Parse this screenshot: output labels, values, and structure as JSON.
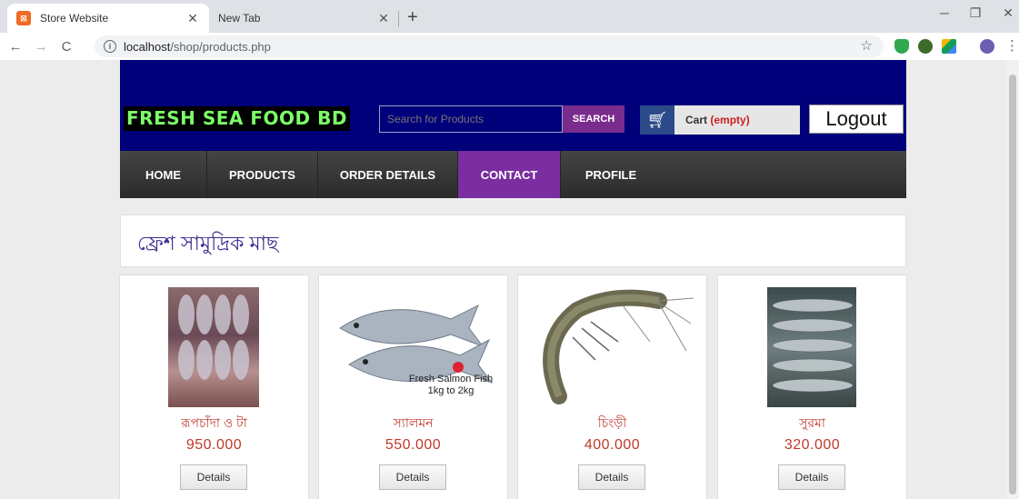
{
  "browser": {
    "tabs": [
      {
        "title": "Store Website",
        "favicon": "xampp-icon"
      },
      {
        "title": "New Tab"
      }
    ],
    "url_host": "localhost",
    "url_path": "/shop/products.php"
  },
  "header": {
    "logo_text": "FRESH SEA FOOD BD",
    "search_placeholder": "Search for Products",
    "search_button": "SEARCH",
    "cart_label": "Cart",
    "cart_status": "(empty)",
    "logout_label": "Logout"
  },
  "nav": {
    "items": [
      {
        "label": "HOME"
      },
      {
        "label": "PRODUCTS"
      },
      {
        "label": "ORDER DETAILS"
      },
      {
        "label": "CONTACT",
        "active": true
      },
      {
        "label": "PROFILE"
      }
    ]
  },
  "section_title": "ফ্রেশ সামুদ্রিক মাছ",
  "products": [
    {
      "name": "রূপচাঁদা ও টা",
      "price": "950.000",
      "button": "Details"
    },
    {
      "name": "স্যালমন",
      "price": "550.000",
      "button": "Details",
      "image_caption": "Fresh Salmon Fish 1kg to 2kg"
    },
    {
      "name": "চিংড়ী",
      "price": "400.000",
      "button": "Details"
    },
    {
      "name": "সুরমা",
      "price": "320.000",
      "button": "Details"
    }
  ],
  "colors": {
    "header_bg": "#00007a",
    "nav_active": "#7a2ea0",
    "price": "#c0392b",
    "logo_green": "#7dff6a"
  }
}
